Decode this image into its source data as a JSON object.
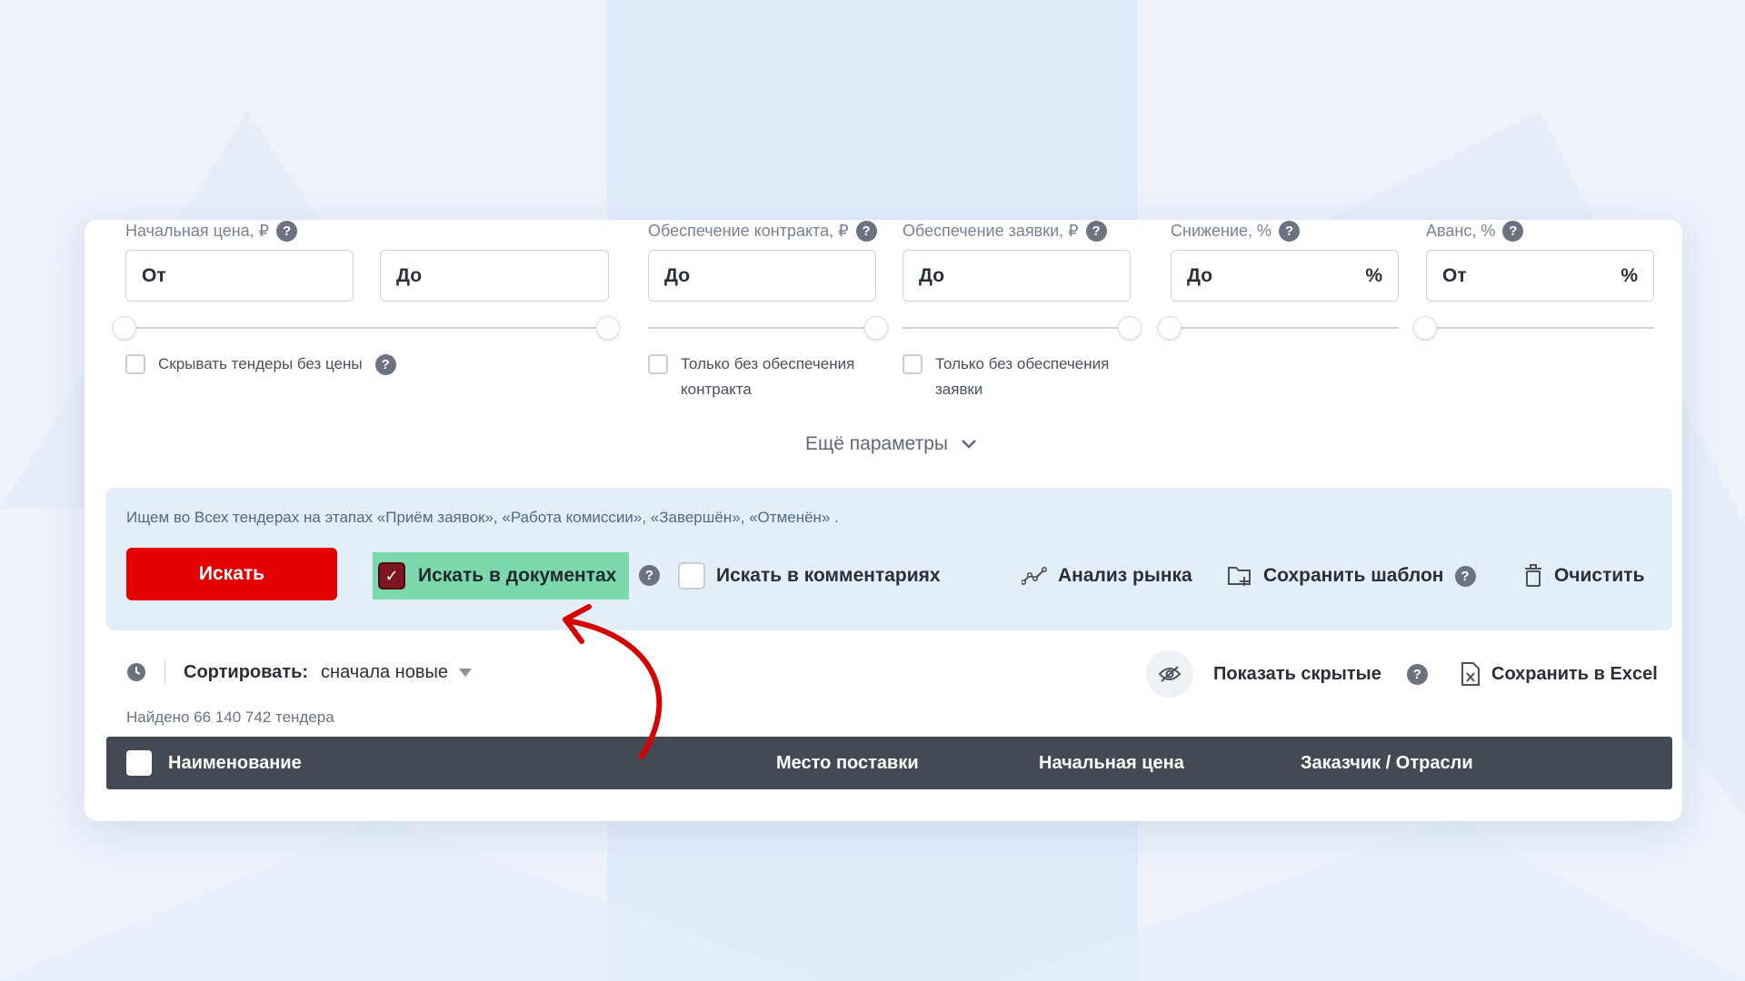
{
  "filters": {
    "start_price": {
      "label": "Начальная цена, ₽",
      "from": "От",
      "to": "До",
      "hide_label": "Скрывать тендеры без цены"
    },
    "contract_security": {
      "label": "Обеспечение контракта, ₽",
      "to": "До",
      "only_label": "Только без обеспечения контракта"
    },
    "bid_security": {
      "label": "Обеспечение заявки, ₽",
      "to": "До",
      "only_label": "Только без обеспечения заявки"
    },
    "reduction": {
      "label": "Снижение, %",
      "to": "До",
      "unit": "%"
    },
    "advance": {
      "label": "Аванс, %",
      "from": "От",
      "unit": "%"
    },
    "more": "Ещё параметры"
  },
  "panel": {
    "info": "Ищем во Всех тендерах на этапах «Приём заявок», «Работа комиссии», «Завершён», «Отменён» .",
    "search_button": "Искать",
    "search_docs": "Искать в документах",
    "search_comments": "Искать в комментариях",
    "market_analysis": "Анализ рынка",
    "save_template": "Сохранить шаблон",
    "clear": "Очистить"
  },
  "sort": {
    "label": "Сортировать:",
    "value": "сначала новые",
    "show_hidden": "Показать скрытые",
    "save_excel": "Сохранить в Excel",
    "found": "Найдено 66 140 742 тендера"
  },
  "table": {
    "columns": [
      "Наименование",
      "Место поставки",
      "Начальная цена",
      "Заказчик / Отрасли"
    ]
  },
  "colors": {
    "accent_red": "#e30000",
    "highlight_green": "#7dd8ae",
    "table_header": "#444a54",
    "panel_bg": "#e3eef8",
    "annotation_arrow": "#d40000"
  }
}
